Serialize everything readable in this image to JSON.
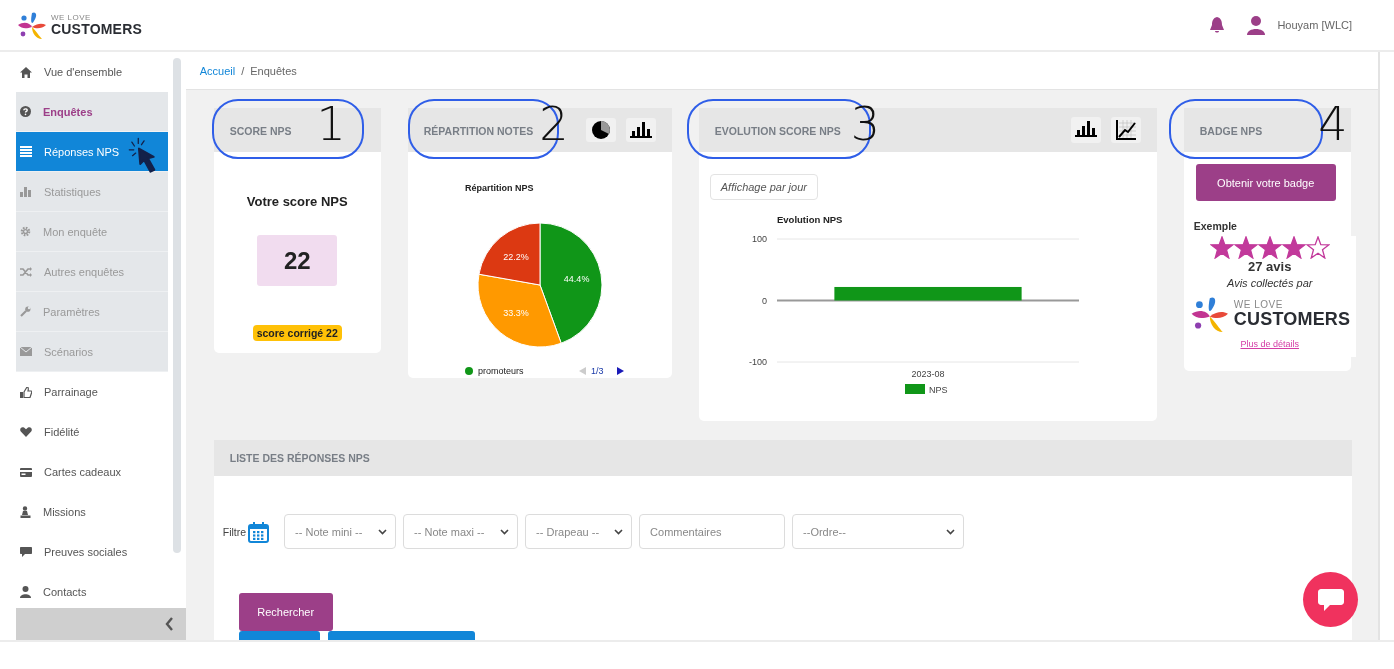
{
  "header": {
    "logo_small": "WE LOVE",
    "logo_big": "CUSTOMERS",
    "user": "Houyam [WLC]"
  },
  "sidebar": {
    "items": [
      {
        "label": "Vue d'ensemble",
        "kind": "link",
        "selected": false
      },
      {
        "label": "Enquêtes",
        "kind": "section",
        "selected": false
      },
      {
        "label": "Réponses NPS",
        "kind": "sub",
        "selected": true
      },
      {
        "label": "Statistiques",
        "kind": "sub",
        "selected": false
      },
      {
        "label": "Mon enquête",
        "kind": "sub",
        "selected": false
      },
      {
        "label": "Autres enquêtes",
        "kind": "sub",
        "selected": false
      },
      {
        "label": "Paramètres",
        "kind": "sub",
        "selected": false
      },
      {
        "label": "Scénarios",
        "kind": "sub",
        "selected": false
      },
      {
        "label": "Parrainage",
        "kind": "link",
        "selected": false
      },
      {
        "label": "Fidélité",
        "kind": "link",
        "selected": false
      },
      {
        "label": "Cartes cadeaux",
        "kind": "link",
        "selected": false
      },
      {
        "label": "Missions",
        "kind": "link",
        "selected": false
      },
      {
        "label": "Preuves sociales",
        "kind": "link",
        "selected": false
      },
      {
        "label": "Contacts",
        "kind": "link",
        "selected": false
      }
    ]
  },
  "breadcrumb": [
    {
      "label": "Accueil",
      "kind": "link"
    },
    {
      "label": "/",
      "kind": "separator"
    },
    {
      "label": "Enquêtes",
      "kind": "current"
    }
  ],
  "cards": [
    {
      "kind": "score",
      "title": "SCORE NPS",
      "annotation": "1",
      "heading": "Votre score NPS",
      "score": "22",
      "badge": "score corrigé 22"
    },
    {
      "kind": "pie",
      "title": "RÉPARTITION NOTES",
      "annotation": "2",
      "chart_data": {
        "type": "pie",
        "title": "Répartition NPS",
        "values": [
          44.4,
          33.3,
          22.2
        ],
        "value_labels": [
          "44.4%",
          "33.3%",
          "22.2%"
        ]
      },
      "legend": "promoteurs",
      "pager": "1/3"
    },
    {
      "kind": "bar",
      "title": "EVOLUTION SCORE NPS",
      "annotation": "3",
      "toggle": "Affichage par jour",
      "chart_data": {
        "type": "bar",
        "title": "Evolution NPS",
        "categories": [
          "2023-08"
        ],
        "series": [
          {
            "name": "NPS",
            "color": "#109618",
            "values": [
              22
            ]
          }
        ],
        "ylim": [
          -100,
          100
        ],
        "yticks": [
          100,
          0,
          -100
        ]
      }
    },
    {
      "kind": "badge",
      "title": "BADGE NPS",
      "annotation": "4",
      "button": "Obtenir votre badge",
      "example": "Exemple",
      "stars": 4,
      "count": "27 avis",
      "collected": "Avis collectés par",
      "logo_small": "WE LOVE",
      "logo_big": "CUSTOMERS",
      "link": "Plus de détails"
    }
  ],
  "list": {
    "title": "LISTE DES RÉPONSES NPS",
    "filter_label": "Filtre",
    "filters": [
      {
        "kind": "select",
        "placeholder": "-- Note mini --"
      },
      {
        "kind": "select",
        "placeholder": "-- Note maxi --"
      },
      {
        "kind": "select",
        "placeholder": "-- Drapeau --"
      },
      {
        "kind": "input",
        "placeholder": "Commentaires"
      },
      {
        "kind": "select",
        "placeholder": "--Ordre--"
      }
    ],
    "button": "Rechercher"
  }
}
